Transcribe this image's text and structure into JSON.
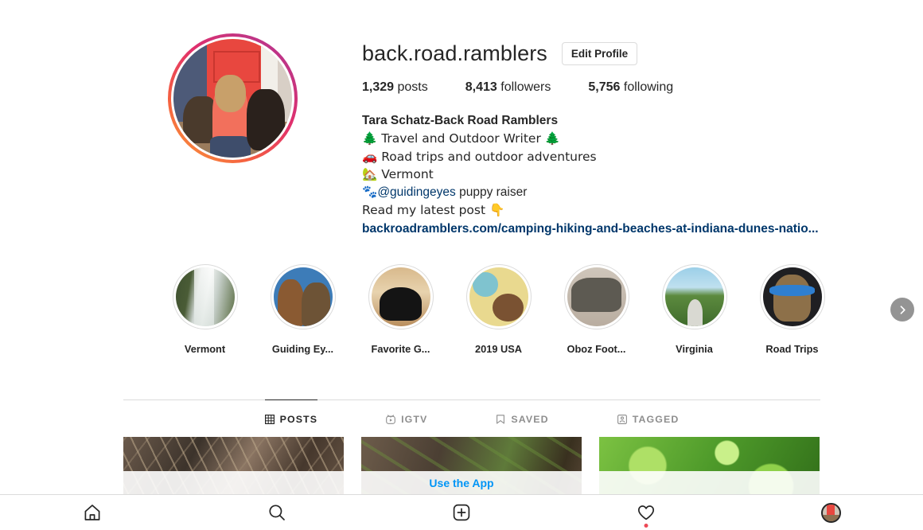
{
  "profile": {
    "username": "back.road.ramblers",
    "edit_profile_label": "Edit Profile",
    "avatar_name": "profile-picture",
    "stats": [
      {
        "value": "1,329",
        "label": "posts"
      },
      {
        "value": "8,413",
        "label": "followers"
      },
      {
        "value": "5,756",
        "label": "following"
      }
    ],
    "bio": {
      "full_name": "Tara Schatz-Back Road Ramblers",
      "line_1": "🌲 Travel and Outdoor Writer 🌲",
      "line_2": "🚗 Road trips and outdoor adventures",
      "line_3": "🏡 Vermont",
      "line_4_emoji": "🐾",
      "line_4_mention": "@guidingeyes",
      "line_4_rest": " puppy raiser",
      "line_5": "Read my latest post 👇",
      "link": "backroadramblers.com/camping-hiking-and-beaches-at-indiana-dunes-natio..."
    }
  },
  "highlights": {
    "scroll_button_name": "highlights-scroll-right-button",
    "items": [
      {
        "label": "Vermont",
        "cover": "c-waterfall"
      },
      {
        "label": "Guiding Ey...",
        "cover": "c-guiding"
      },
      {
        "label": "Favorite G...",
        "cover": "c-cat"
      },
      {
        "label": "2019 USA",
        "cover": "c-usa"
      },
      {
        "label": "Oboz Foot...",
        "cover": "c-boots"
      },
      {
        "label": "Virginia",
        "cover": "c-virginia"
      },
      {
        "label": "Road Trips",
        "cover": "c-roadtrips"
      }
    ]
  },
  "tabs": [
    {
      "label": "POSTS",
      "icon": "grid-icon",
      "active": true
    },
    {
      "label": "IGTV",
      "icon": "igtv-icon",
      "active": false
    },
    {
      "label": "SAVED",
      "icon": "bookmark-icon",
      "active": false
    },
    {
      "label": "TAGGED",
      "icon": "tagged-person-icon",
      "active": false
    }
  ],
  "posts": [
    {
      "name": "post-thumbnail-1",
      "art": "p1"
    },
    {
      "name": "post-thumbnail-2",
      "art": "p2"
    },
    {
      "name": "post-thumbnail-3",
      "art": "p3"
    }
  ],
  "use_app": {
    "label": "Use the App"
  },
  "bottom_nav": {
    "items": [
      {
        "icon": "home-icon",
        "name": "nav-home",
        "badge": false
      },
      {
        "icon": "search-icon",
        "name": "nav-search",
        "badge": false
      },
      {
        "icon": "add-post-icon",
        "name": "nav-add-post",
        "badge": false
      },
      {
        "icon": "heart-icon",
        "name": "nav-activity",
        "badge": true
      },
      {
        "icon": "avatar-icon",
        "name": "nav-profile",
        "badge": false
      }
    ]
  },
  "colors": {
    "accent_blue": "#0095f6",
    "link_navy": "#00376b",
    "notification_red": "#ed4956",
    "text_primary": "#262626",
    "text_muted": "#8e8e8e",
    "border": "#dbdbdb"
  }
}
